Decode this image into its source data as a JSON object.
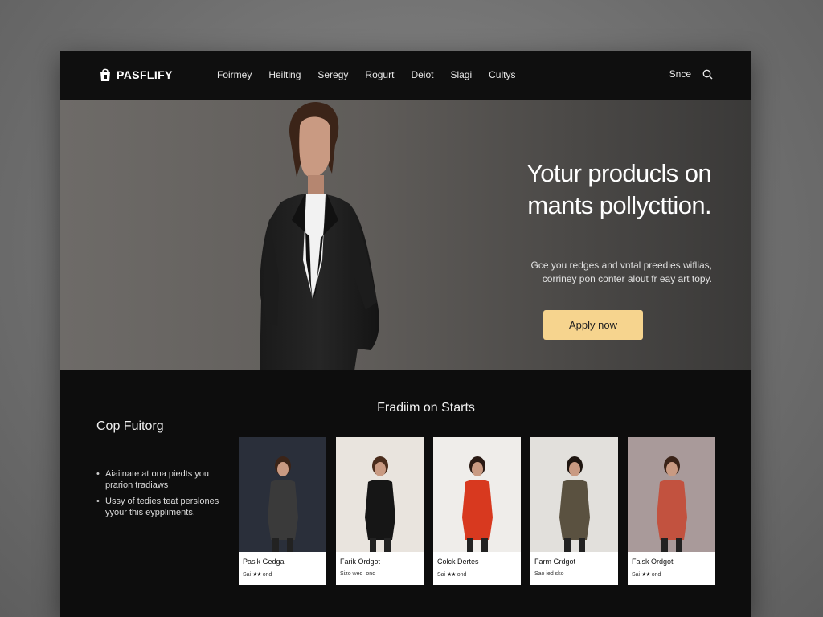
{
  "brand": {
    "name": "PASFLIFY",
    "icon": "shopping-bag-icon"
  },
  "nav": {
    "items": [
      "Foirmey",
      "Heilting",
      "Seregy",
      "Rogurt",
      "Deiot",
      "Slagi",
      "Cultys"
    ],
    "signin": "Snce",
    "search_icon": "search-icon"
  },
  "hero": {
    "title_line1": "Yotur producls on",
    "title_line2": "mants pollycttion.",
    "sub_line1": "Gce you redges and vntal preedies wiflias,",
    "sub_line2": "corriney pon conter alout fr eay art topy.",
    "cta": "Apply now",
    "colors": {
      "cta": "#f6d48e"
    }
  },
  "section": {
    "title": "Fradiim on Starts",
    "side_title": "Cop Fuitorg",
    "bullets": [
      "Aiaiinate at ona piedts you prarion tradiaws",
      "Ussy of tedies teat perslones yyour this eyppliments."
    ]
  },
  "products": [
    {
      "name": "Paslk Gedga",
      "meta": "Sai",
      "stars": "★★",
      "meta2": "ond",
      "bg": "#2a2f3a",
      "outfit": "#3a3a3a",
      "hair": "#3b2418"
    },
    {
      "name": "Farik Ordgot",
      "meta": "Sizo wed",
      "stars": "",
      "meta2": "ond",
      "bg": "#e9e4de",
      "outfit": "#161616",
      "hair": "#4a2c1c"
    },
    {
      "name": "Colck Dertes",
      "meta": "Sai",
      "stars": "★★",
      "meta2": "ond",
      "bg": "#efedea",
      "outfit": "#d8391f",
      "hair": "#2a1a14"
    },
    {
      "name": "Farm Grdgot",
      "meta": "Sao ied sko",
      "stars": "",
      "meta2": "",
      "bg": "#e2e0dc",
      "outfit": "#5a5140",
      "hair": "#1e1510"
    },
    {
      "name": "Falsk Ordgot",
      "meta": "Sai",
      "stars": "★★",
      "meta2": "ond",
      "bg": "#a99a9a",
      "outfit": "#c2523f",
      "hair": "#3a2318"
    }
  ]
}
